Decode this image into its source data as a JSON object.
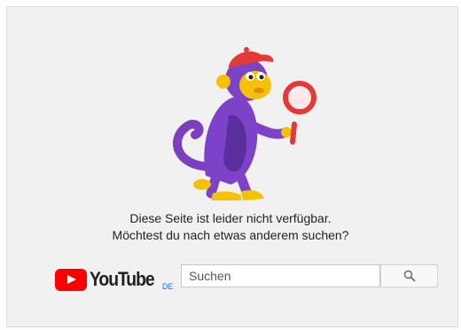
{
  "error": {
    "line1": "Diese Seite ist leider nicht verfügbar.",
    "line2": "Möchtest du nach etwas anderem suchen?"
  },
  "logo": {
    "wordmark": "YouTube",
    "country_code": "DE",
    "brand_color": "#ff0000"
  },
  "search": {
    "placeholder": "Suchen",
    "button_icon": "search-icon"
  },
  "illustration": {
    "icon": "monkey-with-magnifier-icon"
  }
}
